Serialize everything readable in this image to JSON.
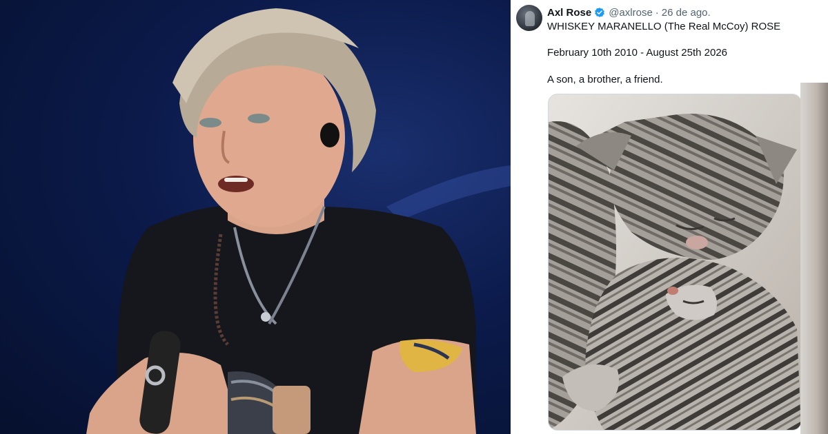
{
  "tweet": {
    "author_name": "Axl Rose",
    "handle": "@axlrose",
    "separator": "·",
    "date": "26 de ago.",
    "line1": "WHISKEY MARANELLO (The Real McCoy) ROSE",
    "line2": "February 10th 2010 - August 25th 2026",
    "line3": "A son, a brother, a friend.",
    "verified_color": "#1d9bf0",
    "media_icon": "cat-photo"
  },
  "photo": {
    "icon": "singer-photo"
  }
}
